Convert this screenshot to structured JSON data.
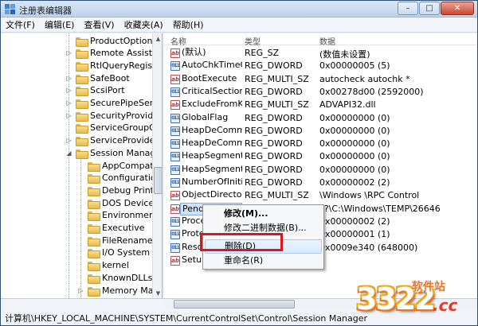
{
  "window": {
    "title": "注册表编辑器",
    "minimize_glyph": "–",
    "maximize_glyph": "□",
    "close_glyph": "✕"
  },
  "menu": [
    "文件(F)",
    "编辑(E)",
    "查看(V)",
    "收藏夹(A)",
    "帮助(H)"
  ],
  "tree": [
    {
      "label": "ProductOptions",
      "expander": "",
      "level": 0
    },
    {
      "label": "Remote Assistar",
      "expander": "▷",
      "level": 0
    },
    {
      "label": "RtlQueryRegistry",
      "expander": "",
      "level": 0
    },
    {
      "label": "SafeBoot",
      "expander": "▷",
      "level": 0
    },
    {
      "label": "ScsiPort",
      "expander": "▷",
      "level": 0
    },
    {
      "label": "SecurePipeServe",
      "expander": "▷",
      "level": 0
    },
    {
      "label": "SecurityProvider",
      "expander": "▷",
      "level": 0
    },
    {
      "label": "ServiceGroupOr",
      "expander": "",
      "level": 0
    },
    {
      "label": "ServiceProvider",
      "expander": "▷",
      "level": 0
    },
    {
      "label": "Session Manage",
      "expander": "◢",
      "level": 0
    },
    {
      "label": "AppCompatC",
      "expander": "",
      "level": 1
    },
    {
      "label": "Configuration",
      "expander": "",
      "level": 1
    },
    {
      "label": "Debug Print I",
      "expander": "",
      "level": 1
    },
    {
      "label": "DOS Devices",
      "expander": "",
      "level": 1
    },
    {
      "label": "Environment",
      "expander": "",
      "level": 1
    },
    {
      "label": "Executive",
      "expander": "",
      "level": 1
    },
    {
      "label": "FileRenameO",
      "expander": "",
      "level": 1
    },
    {
      "label": "I/O System",
      "expander": "",
      "level": 1
    },
    {
      "label": "kernel",
      "expander": "",
      "level": 1
    },
    {
      "label": "KnownDLLs",
      "expander": "",
      "level": 1
    },
    {
      "label": "Memory Man",
      "expander": "▷",
      "level": 1
    }
  ],
  "list": {
    "headers": {
      "name": "名称",
      "type": "类型",
      "data": "数据"
    },
    "rows": [
      {
        "icon": "string-value-icon",
        "icon_text": "ab",
        "name": "(默认)",
        "type": "REG_SZ",
        "data": "(数值未设置)"
      },
      {
        "icon": "binary-value-icon",
        "icon_text": "011",
        "name": "AutoChkTimeO...",
        "type": "REG_DWORD",
        "data": "0x00000005 (5)"
      },
      {
        "icon": "string-value-icon",
        "icon_text": "ab",
        "name": "BootExecute",
        "type": "REG_MULTI_SZ",
        "data": "autocheck autochk *"
      },
      {
        "icon": "binary-value-icon",
        "icon_text": "011",
        "name": "CriticalSection...",
        "type": "REG_DWORD",
        "data": "0x00278d00 (2592000)"
      },
      {
        "icon": "string-value-icon",
        "icon_text": "ab",
        "name": "ExcludeFromK...",
        "type": "REG_MULTI_SZ",
        "data": "ADVAPI32.dll"
      },
      {
        "icon": "binary-value-icon",
        "icon_text": "011",
        "name": "GlobalFlag",
        "type": "REG_DWORD",
        "data": "0x00000000 (0)"
      },
      {
        "icon": "binary-value-icon",
        "icon_text": "011",
        "name": "HeapDeComm...",
        "type": "REG_DWORD",
        "data": "0x00000000 (0)"
      },
      {
        "icon": "binary-value-icon",
        "icon_text": "011",
        "name": "HeapDeComm...",
        "type": "REG_DWORD",
        "data": "0x00000000 (0)"
      },
      {
        "icon": "binary-value-icon",
        "icon_text": "011",
        "name": "HeapSegment...",
        "type": "REG_DWORD",
        "data": "0x00000000 (0)"
      },
      {
        "icon": "binary-value-icon",
        "icon_text": "011",
        "name": "HeapSegment...",
        "type": "REG_DWORD",
        "data": "0x00000000 (0)"
      },
      {
        "icon": "binary-value-icon",
        "icon_text": "011",
        "name": "NumberOfIniti...",
        "type": "REG_DWORD",
        "data": "0x00000002 (2)"
      },
      {
        "icon": "string-value-icon",
        "icon_text": "ab",
        "name": "ObjectDirector...",
        "type": "REG_MULTI_SZ",
        "data": "\\Windows \\RPC Control"
      },
      {
        "icon": "string-value-icon",
        "icon_text": "ab",
        "name": "Pendi",
        "type": "",
        "data": "??\\C:\\Windows\\TEMP\\26646",
        "selected": true
      },
      {
        "icon": "binary-value-icon",
        "icon_text": "011",
        "name": "Proce",
        "type": "",
        "data": "0x00000002 (2)"
      },
      {
        "icon": "binary-value-icon",
        "icon_text": "011",
        "name": "Prote",
        "type": "",
        "data": "0x00000001 (1)"
      },
      {
        "icon": "binary-value-icon",
        "icon_text": "011",
        "name": "Reso",
        "type": "",
        "data": "0x0009e340 (648000)"
      },
      {
        "icon": "string-value-icon",
        "icon_text": "ab",
        "name": "Setup",
        "type": "",
        "data": ""
      }
    ]
  },
  "context_menu": {
    "modify": "修改(M)...",
    "modify_binary": "修改二进制数据(B)...",
    "delete": "删除(D)",
    "rename": "重命名(R)"
  },
  "status_bar": {
    "path": "计算机\\HKEY_LOCAL_MACHINE\\SYSTEM\\CurrentControlSet\\Control\\Session Manager"
  },
  "watermark": {
    "number": "3322",
    "site": "软件站",
    "domain": ".cc"
  },
  "colors": {
    "highlight": "#e0141b",
    "selection": "#cfe3f8"
  }
}
